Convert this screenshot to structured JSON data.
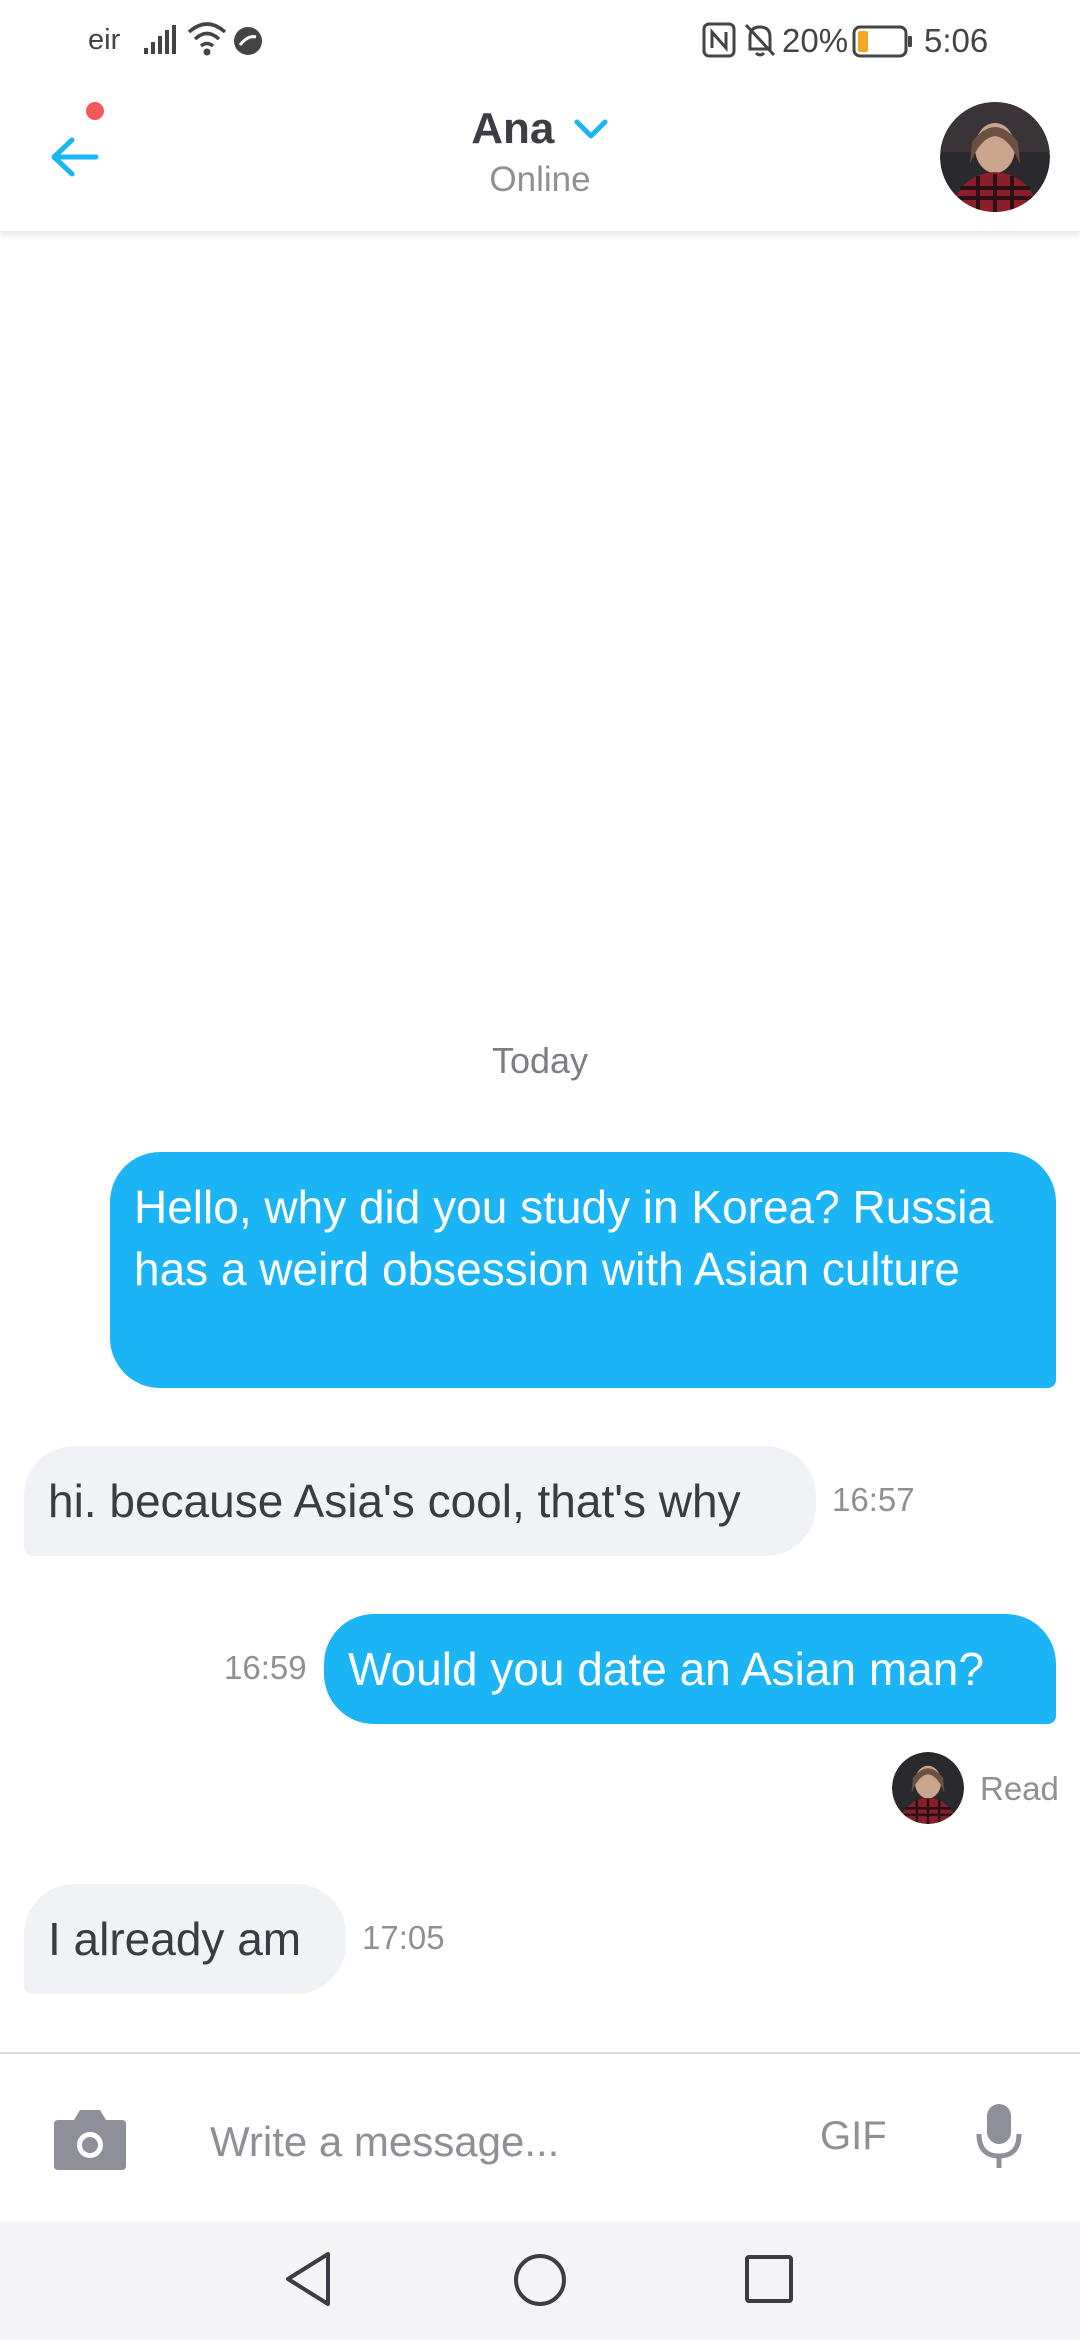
{
  "status_bar": {
    "carrier": "eir",
    "battery_percent": "20%",
    "time": "5:06",
    "icons": [
      "signal-icon",
      "wifi-icon",
      "dnd-icon",
      "nfc-icon",
      "mute-icon",
      "battery-icon"
    ]
  },
  "header": {
    "contact_name": "Ana",
    "contact_status": "Online",
    "back_icon": "arrow-left-icon",
    "chevron_icon": "chevron-down-icon",
    "has_notification_dot": true,
    "accent_color": "#1bb5f6"
  },
  "conversation": {
    "date_separator": "Today",
    "messages": [
      {
        "direction": "outgoing",
        "text": "Hello, why did you study in Korea? Russia has a weird obsession with Asian culture",
        "time": ""
      },
      {
        "direction": "incoming",
        "text": "hi. because Asia's cool, that's why",
        "time": "16:57"
      },
      {
        "direction": "outgoing",
        "text": "Would you date an Asian man?",
        "time": "16:59"
      },
      {
        "direction": "incoming",
        "text": "I already am",
        "time": "17:05"
      }
    ],
    "read_receipt": "Read"
  },
  "composer": {
    "placeholder": "Write a message...",
    "gif_label": "GIF",
    "camera_icon": "camera-icon",
    "mic_icon": "microphone-icon"
  },
  "navbar": {
    "icons": [
      "nav-back-icon",
      "nav-home-icon",
      "nav-recents-icon"
    ]
  },
  "colors": {
    "outgoing_bubble": "#1bb5f6",
    "incoming_bubble": "#f1f2f5",
    "notification_dot": "#f25a5a",
    "battery_low": "#f5a623"
  }
}
